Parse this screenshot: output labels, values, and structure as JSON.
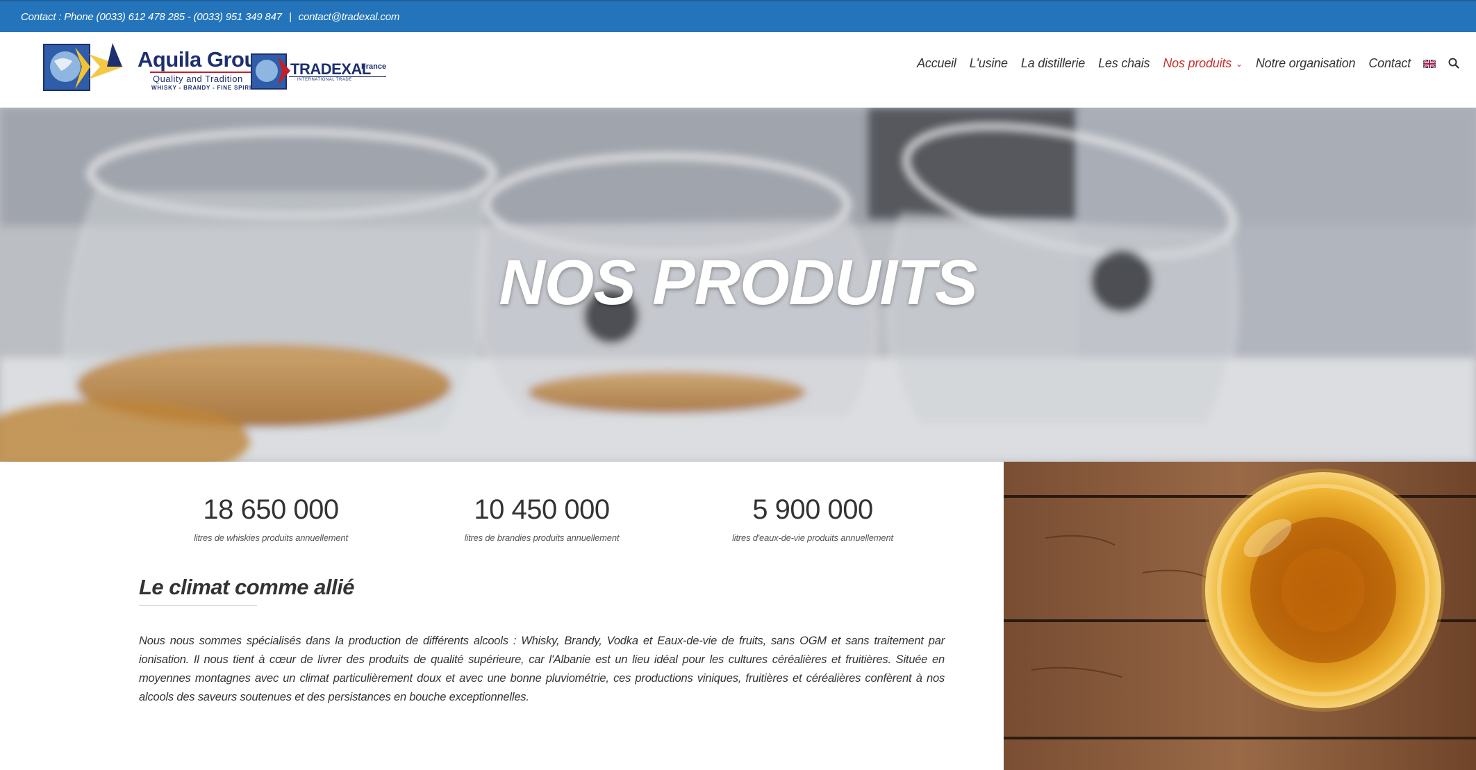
{
  "topbar": {
    "contact_phone": "Contact : Phone (0033) 612 478 285 - (0033) 951 349 847",
    "separator": "|",
    "email": "contact@tradexal.com"
  },
  "logos": {
    "aquila": {
      "name": "Aquila Group",
      "tagline": "Quality and Tradition",
      "sub": "WHISKY - BRANDY - FINE SPIRITS"
    },
    "tradexal": {
      "name": "TRADEXAL",
      "country": "France",
      "sub": "INTERNATIONAL TRADE"
    }
  },
  "nav": {
    "items": [
      {
        "label": "Accueil"
      },
      {
        "label": "L'usine"
      },
      {
        "label": "La distillerie"
      },
      {
        "label": "Les chais"
      },
      {
        "label": "Nos produits",
        "active": true
      },
      {
        "label": "Notre organisation"
      },
      {
        "label": "Contact"
      }
    ],
    "language_icon": "uk-flag-icon",
    "search_icon": "search-icon"
  },
  "hero": {
    "title": "NOS PRODUITS"
  },
  "stats": [
    {
      "value": "18 650 000",
      "label": "litres de whiskies produits annuellement"
    },
    {
      "value": "10 450 000",
      "label": "litres de brandies produits annuellement"
    },
    {
      "value": "5 900 000",
      "label": "litres d'eaux-de-vie produits annuellement"
    }
  ],
  "section": {
    "title": "Le climat comme allié",
    "body": "Nous nous sommes spécialisés dans la production de différents alcools : Whisky, Brandy, Vodka et Eaux-de-vie de fruits, sans OGM et sans traitement par ionisation. Il nous tient à cœur de livrer des produits de qualité supérieure, car l'Albanie est un lieu idéal pour les cultures céréalières et fruitières. Située en moyennes montagnes avec un climat particulièrement doux et avec une bonne pluviométrie, ces productions viniques, fruitières et céréalières confèrent à nos alcools des saveurs soutenues et des persistances en bouche exceptionnelles."
  },
  "colors": {
    "topbar": "#2474bb",
    "nav_active": "#c9302c",
    "text": "#333333",
    "logo_navy": "#1d2f6f"
  }
}
